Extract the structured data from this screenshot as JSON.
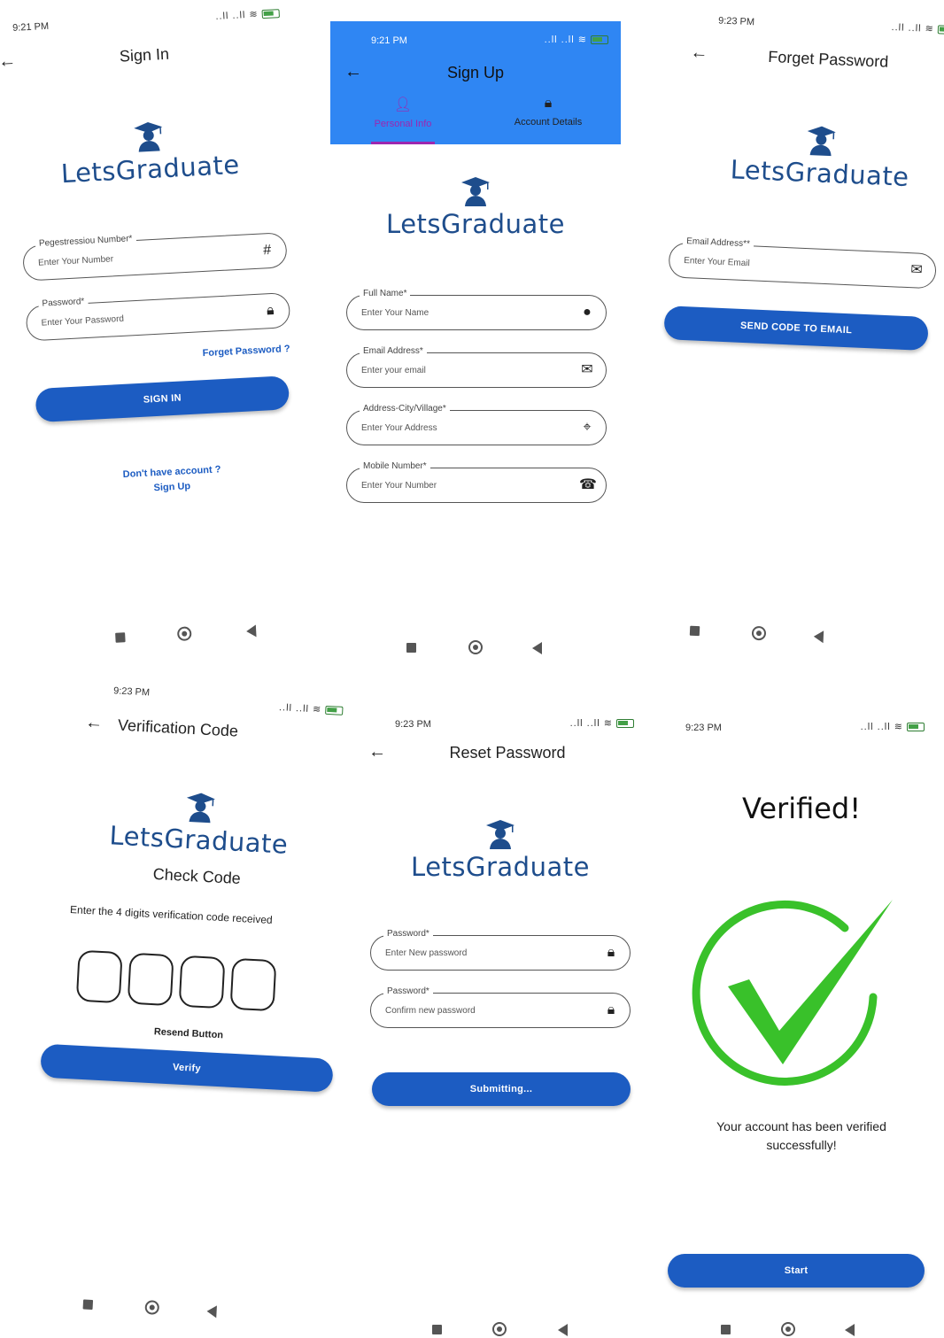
{
  "status_bar": {
    "time_s1": "9:21 PM",
    "time_s2": "9:21 PM",
    "time_s3": "9:23 PM",
    "time_s4": "9:23 PM",
    "time_s5": "9:23 PM",
    "time_s6": "9:23 PM",
    "icons_text": "☏ ..ll ..ll ≈"
  },
  "brand": {
    "name": "LetsGraduate"
  },
  "sign_in": {
    "title": "Sign In",
    "reg_label": "Pegestressiou Number*",
    "reg_placeholder": "Enter Your Number",
    "pwd_label": "Password*",
    "pwd_placeholder": "Enter Your Password",
    "forget_link": "Forget Password ?",
    "sign_in_button": "SIGN IN",
    "no_account": "Don't have account ?",
    "sign_up_link": "Sign Up"
  },
  "sign_up": {
    "title": "Sign Up",
    "tab_personal": "Personal Info",
    "tab_account": "Account Details",
    "name_label": "Full Name*",
    "name_placeholder": "Enter Your Name",
    "email_label": "Email Address*",
    "email_placeholder": "Enter your email",
    "address_label": "Address-City/Village*",
    "address_placeholder": "Enter Your Address",
    "mobile_label": "Mobile Number*",
    "mobile_placeholder": "Enter Your Number"
  },
  "forget_password": {
    "title": "Forget Password",
    "email_label": "Email Address**",
    "email_placeholder": "Enter Your Email",
    "send_button": "SEND CODE TO EMAIL"
  },
  "verification": {
    "title": "Verification Code",
    "subtitle": "Check Code",
    "instruction": "Enter the 4 digits verification code received",
    "resend": "Resend Button",
    "verify_button": "Verify"
  },
  "reset_password": {
    "title": "Reset Password",
    "new_label": "Password*",
    "new_placeholder": "Enter New password",
    "confirm_label": "Password*",
    "confirm_placeholder": "Confirm new password",
    "submit_button": "Submitting..."
  },
  "verified": {
    "title": "Verified!",
    "message": "Your account has been verified successfully!",
    "start_button": "Start"
  },
  "colors": {
    "brand_blue": "#1e4d8c",
    "button_blue": "#1c5cc2",
    "header_blue": "#2f86f3",
    "tab_active": "#9c27b0",
    "check_green": "#39c12a"
  }
}
